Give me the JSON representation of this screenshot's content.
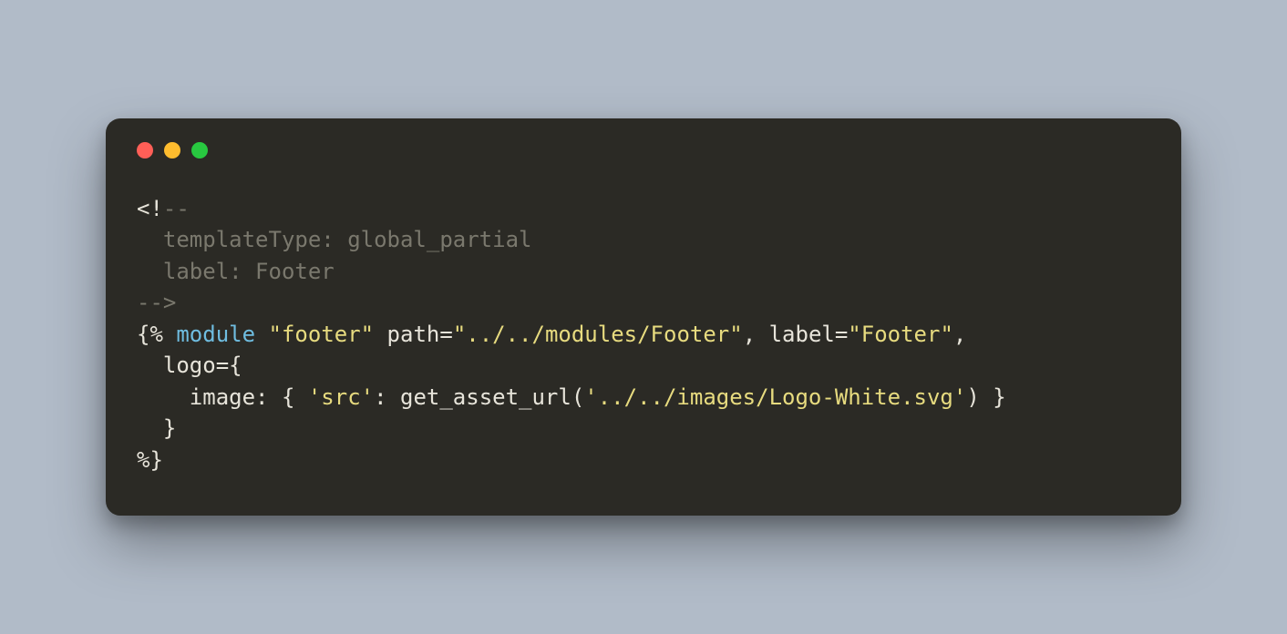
{
  "traffic_lights": {
    "red": "#ff5f57",
    "yellow": "#febc2e",
    "green": "#28c840"
  },
  "code": {
    "c1": "<!",
    "c1b": "--",
    "c2": "  templateType: global_partial",
    "c3": "  label: Footer",
    "c4": "-->",
    "l5a": "{% ",
    "l5b": "module",
    "l5c": " ",
    "l5d": "\"footer\"",
    "l5e": " path=",
    "l5f": "\"../../modules/Footer\"",
    "l5g": ", label=",
    "l5h": "\"Footer\"",
    "l5i": ",",
    "l6": "  logo={",
    "l7a": "    image: { ",
    "l7b": "'src'",
    "l7c": ": get_asset_url(",
    "l7d": "'../../images/Logo-White.svg'",
    "l7e": ") }",
    "l8": "  }",
    "l9": "%}"
  }
}
